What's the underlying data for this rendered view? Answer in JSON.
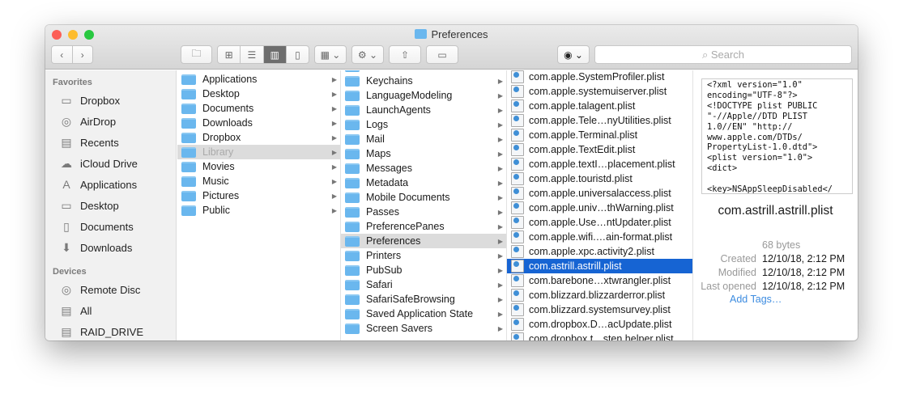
{
  "window": {
    "title": "Preferences"
  },
  "toolbar": {
    "back": "‹",
    "forward": "›",
    "search_placeholder": "Search"
  },
  "sidebar": {
    "favorites_header": "Favorites",
    "favorites": [
      {
        "label": "Dropbox",
        "icon": "folder-icon"
      },
      {
        "label": "AirDrop",
        "icon": "airdrop-icon"
      },
      {
        "label": "Recents",
        "icon": "recents-icon"
      },
      {
        "label": "iCloud Drive",
        "icon": "cloud-icon"
      },
      {
        "label": "Applications",
        "icon": "applications-icon"
      },
      {
        "label": "Desktop",
        "icon": "desktop-icon"
      },
      {
        "label": "Documents",
        "icon": "documents-icon"
      },
      {
        "label": "Downloads",
        "icon": "downloads-icon"
      }
    ],
    "devices_header": "Devices",
    "devices": [
      {
        "label": "Remote Disc",
        "icon": "disc-icon"
      },
      {
        "label": "All",
        "icon": "drive-icon"
      },
      {
        "label": "RAID_DRIVE",
        "icon": "drive-icon"
      }
    ]
  },
  "column1": [
    "Applications",
    "Desktop",
    "Documents",
    "Downloads",
    "Dropbox",
    "Library",
    "Movies",
    "Music",
    "Pictures",
    "Public"
  ],
  "column1_selected": "Library",
  "column2": [
    "Keychains",
    "LanguageModeling",
    "LaunchAgents",
    "Logs",
    "Mail",
    "Maps",
    "Messages",
    "Metadata",
    "Mobile Documents",
    "Passes",
    "PreferencePanes",
    "Preferences",
    "Printers",
    "PubSub",
    "Safari",
    "SafariSafeBrowsing",
    "Saved Application State",
    "Screen Savers"
  ],
  "column2_selected": "Preferences",
  "column3": [
    "com.apple.SystemProfiler.plist",
    "com.apple.systemuiserver.plist",
    "com.apple.talagent.plist",
    "com.apple.Tele…nyUtilities.plist",
    "com.apple.Terminal.plist",
    "com.apple.TextEdit.plist",
    "com.apple.textI…placement.plist",
    "com.apple.touristd.plist",
    "com.apple.universalaccess.plist",
    "com.apple.univ…thWarning.plist",
    "com.apple.Use…ntUpdater.plist",
    "com.apple.wifi.…ain-format.plist",
    "com.apple.xpc.activity2.plist",
    "com.astrill.astrill.plist",
    "com.barebone…xtwrangler.plist",
    "com.blizzard.blizzarderror.plist",
    "com.blizzard.systemsurvey.plist",
    "com.dropbox.D…acUpdate.plist",
    "com.dropbox.t…sten.helper.plist"
  ],
  "column3_selected": "com.astrill.astrill.plist",
  "preview": {
    "code": "<?xml version=\"1.0\"\nencoding=\"UTF-8\"?>\n<!DOCTYPE plist PUBLIC\n\"-//Apple//DTD PLIST\n1.0//EN\" \"http://\nwww.apple.com/DTDs/\nPropertyList-1.0.dtd\">\n<plist version=\"1.0\">\n<dict>\n\n<key>NSAppSleepDisabled</",
    "filename": "com.astrill.astrill.plist",
    "size": "68 bytes",
    "created_label": "Created",
    "created": "12/10/18, 2:12 PM",
    "modified_label": "Modified",
    "modified": "12/10/18, 2:12 PM",
    "opened_label": "Last opened",
    "opened": "12/10/18, 2:12 PM",
    "add_tags": "Add Tags…"
  },
  "colors": {
    "selection": "#1664d3",
    "folder": "#6ab7ee",
    "link": "#3d8ce0"
  }
}
